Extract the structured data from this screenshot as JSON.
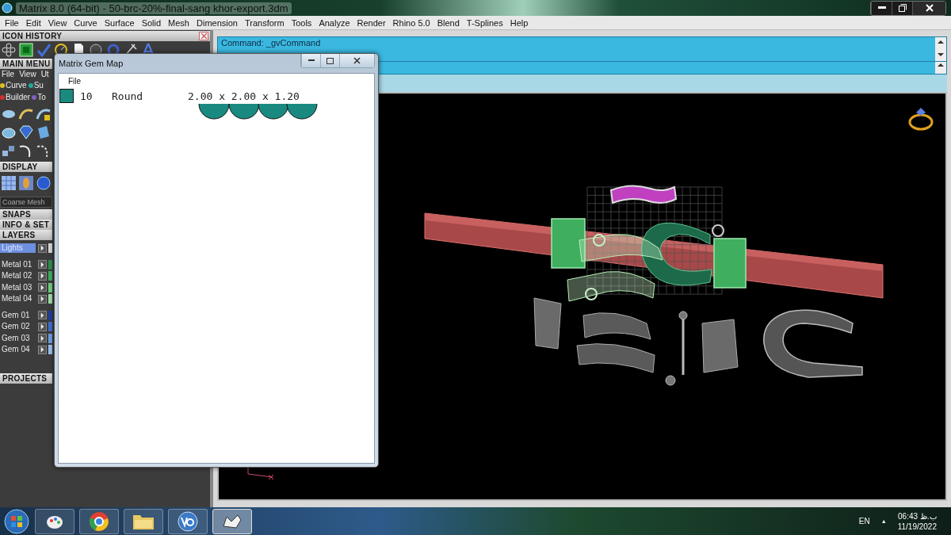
{
  "window": {
    "title": "Matrix 8.0 (64-bit) - 50-brc-20%-final-sang khor-export.3dm"
  },
  "menu_bar": [
    "File",
    "Edit",
    "View",
    "Curve",
    "Surface",
    "Solid",
    "Mesh",
    "Dimension",
    "Transform",
    "Tools",
    "Analyze",
    "Render",
    "Rhino 5.0",
    "Blend",
    "T-Splines",
    "Help"
  ],
  "left_panel": {
    "icon_history": {
      "title": "ICON HISTORY"
    },
    "main_menu": {
      "title": "MAIN MENU",
      "menus": [
        "File",
        "View",
        "Ut"
      ],
      "tabs": [
        {
          "label": "Curve",
          "color": "#e0c020"
        },
        {
          "label": "Su",
          "color": "#20a8a0"
        },
        {
          "label": "Builder",
          "color": "#d03030"
        },
        {
          "label": "To",
          "color": "#8060c0"
        }
      ]
    },
    "display": {
      "title": "DISPLAY",
      "mode": "Coarse Mesh"
    },
    "sections": [
      "SNAPS",
      "INFO & SET",
      "LAYERS"
    ],
    "layers": [
      {
        "name": "Lights",
        "selected": true,
        "color": "#d8d8d8"
      },
      {
        "name": "Metal 01",
        "selected": false,
        "color": "#2f8f4f"
      },
      {
        "name": "Metal 02",
        "selected": false,
        "color": "#3fae5f"
      },
      {
        "name": "Metal 03",
        "selected": false,
        "color": "#6fd07f"
      },
      {
        "name": "Metal 04",
        "selected": false,
        "color": "#9fdfa8"
      },
      {
        "name": "Gem 01",
        "selected": false,
        "color": "#1f3f9f"
      },
      {
        "name": "Gem 02",
        "selected": false,
        "color": "#3f6fcf"
      },
      {
        "name": "Gem 03",
        "selected": false,
        "color": "#6f9fdf"
      },
      {
        "name": "Gem 04",
        "selected": false,
        "color": "#9fc0ef"
      }
    ],
    "projects": {
      "title": "PROJECTS"
    }
  },
  "command": {
    "line": "Command: _gvCommand"
  },
  "gem_map": {
    "title": "Matrix Gem Map",
    "menu": [
      "File"
    ],
    "gems": [
      {
        "count": "10",
        "shape": "Round",
        "size": "2.00 x 2.00 x 1.20",
        "color": "#1a8a80"
      }
    ]
  },
  "taskbar": {
    "language": "EN",
    "tray_arrow": "▲",
    "time": "ب.ظ 06:43",
    "date": "11/19/2022"
  }
}
